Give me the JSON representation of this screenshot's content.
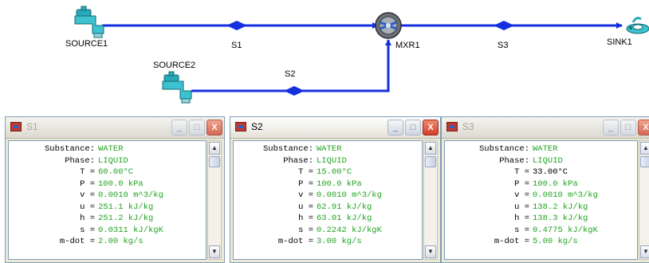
{
  "flowsheet": {
    "nodes": [
      {
        "id": "source1",
        "label": "SOURCE1",
        "icon": "faucet-icon"
      },
      {
        "id": "source2",
        "label": "SOURCE2",
        "icon": "faucet-icon"
      },
      {
        "id": "mixer",
        "label": "MXR1",
        "icon": "mixer-icon"
      },
      {
        "id": "sink",
        "label": "SINK1",
        "icon": "drain-icon"
      }
    ],
    "streams": [
      {
        "id": "s1",
        "label": "S1"
      },
      {
        "id": "s2",
        "label": "S2"
      },
      {
        "id": "s3",
        "label": "S3"
      }
    ],
    "colors": {
      "stream": "#1530e0",
      "unit_teal": "#2aa9b8",
      "value_green": "#22a422"
    }
  },
  "windows": [
    {
      "title": "S1",
      "active": false,
      "props": [
        {
          "label": "Substance:",
          "value": "WATER",
          "color": "green"
        },
        {
          "label": "Phase:",
          "value": "LIQUID",
          "color": "green"
        },
        {
          "label": "T =",
          "value": "60.00°C",
          "color": "green"
        },
        {
          "label": "P =",
          "value": "100.0 kPa",
          "color": "green"
        },
        {
          "label": "v =",
          "value": "0.0010 m^3/kg",
          "color": "green"
        },
        {
          "label": "u =",
          "value": "251.1 kJ/kg",
          "color": "green"
        },
        {
          "label": "h =",
          "value": "251.2 kJ/kg",
          "color": "green"
        },
        {
          "label": "s =",
          "value": "0.0311 kJ/kgK",
          "color": "green"
        },
        {
          "label": "m-dot =",
          "value": "2.00 kg/s",
          "color": "green"
        }
      ]
    },
    {
      "title": "S2",
      "active": true,
      "props": [
        {
          "label": "Substance:",
          "value": "WATER",
          "color": "green"
        },
        {
          "label": "Phase:",
          "value": "LIQUID",
          "color": "green"
        },
        {
          "label": "T =",
          "value": "15.00°C",
          "color": "green"
        },
        {
          "label": "P =",
          "value": "100.0 kPa",
          "color": "green"
        },
        {
          "label": "v =",
          "value": "0.0010 m^3/kg",
          "color": "green"
        },
        {
          "label": "u =",
          "value": "62.91 kJ/kg",
          "color": "green"
        },
        {
          "label": "h =",
          "value": "63.01 kJ/kg",
          "color": "green"
        },
        {
          "label": "s =",
          "value": "0.2242 kJ/kgK",
          "color": "green"
        },
        {
          "label": "m-dot =",
          "value": "3.00 kg/s",
          "color": "green"
        }
      ]
    },
    {
      "title": "S3",
      "active": false,
      "props": [
        {
          "label": "Substance:",
          "value": "WATER",
          "color": "green"
        },
        {
          "label": "Phase:",
          "value": "LIQUID",
          "color": "green"
        },
        {
          "label": "T =",
          "value": "33.00°C",
          "color": "black"
        },
        {
          "label": "P =",
          "value": "100.0 kPa",
          "color": "green"
        },
        {
          "label": "v =",
          "value": "0.0010 m^3/kg",
          "color": "green"
        },
        {
          "label": "u =",
          "value": "138.2 kJ/kg",
          "color": "green"
        },
        {
          "label": "h =",
          "value": "138.3 kJ/kg",
          "color": "green"
        },
        {
          "label": "s =",
          "value": "0.4775 kJ/kgK",
          "color": "green"
        },
        {
          "label": "m-dot =",
          "value": "5.00 kg/s",
          "color": "green"
        }
      ]
    }
  ],
  "window_controls": {
    "minimize": "_",
    "maximize": "□",
    "close": "X"
  }
}
